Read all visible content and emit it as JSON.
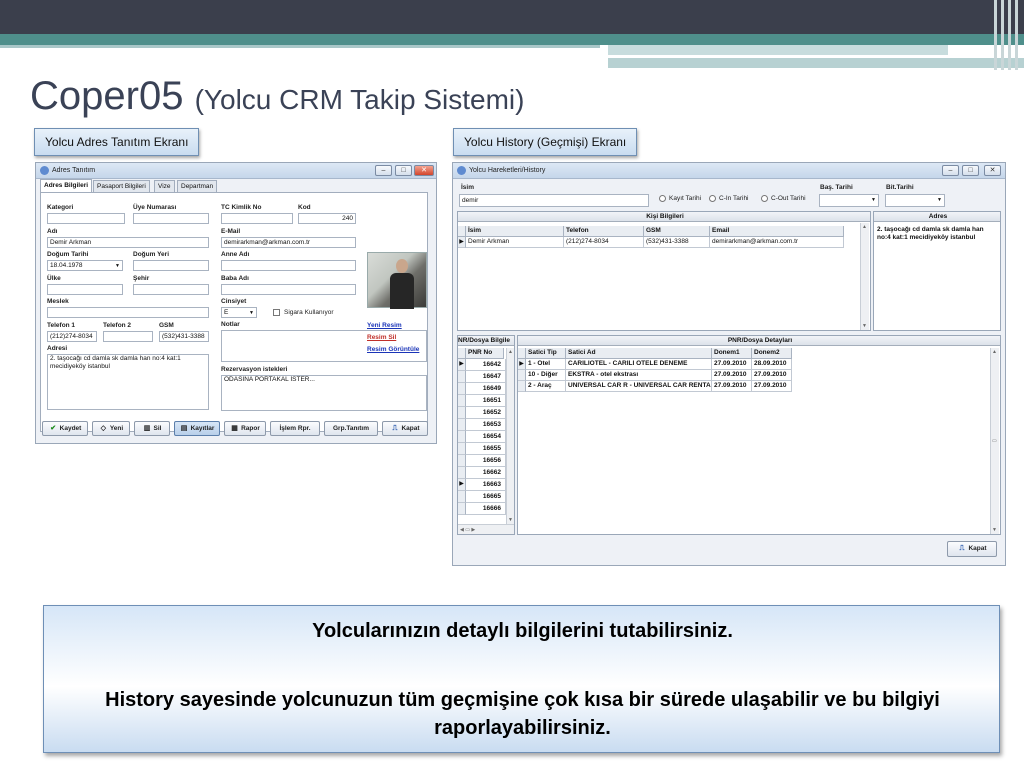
{
  "slide": {
    "title_main": "Coper05",
    "title_sub": "(Yolcu CRM Takip Sistemi)",
    "caption_left": "Yolcu Adres Tanıtım Ekranı",
    "caption_right": "Yolcu History (Geçmişi) Ekranı",
    "info_line1": "Yolcularınızın detaylı bilgilerini tutabilirsiniz.",
    "info_line2": "History sayesinde yolcunuzun tüm geçmişine çok kısa bir sürede ulaşabilir ve bu bilgiyi raporlayabilirsiniz."
  },
  "adres": {
    "window_title": "Adres Tanıtım",
    "tabs": [
      "Adres Bilgileri",
      "Pasaport Bilgileri",
      "Vize",
      "Departman"
    ],
    "labels": {
      "kategori": "Kategori",
      "uye_no": "Üye Numarası",
      "tc": "TC Kimlik No",
      "kod": "Kod",
      "adi": "Adı",
      "email": "E-Mail",
      "dogum_tarihi": "Doğum Tarihi",
      "dogum_yeri": "Doğum Yeri",
      "anne": "Anne Adı",
      "ulke": "Ülke",
      "sehir": "Şehir",
      "baba": "Baba Adı",
      "meslek": "Meslek",
      "cinsiyet": "Cinsiyet",
      "sigara": "Sigara Kullanıyor",
      "tel1": "Telefon 1",
      "tel2": "Telefon 2",
      "gsm": "GSM",
      "notlar": "Notlar",
      "adresi": "Adresi",
      "rezervasyon": "Rezervasyon istekleri"
    },
    "values": {
      "kod": "240",
      "adi": "Demir Arkman",
      "email": "demirarkman@arkman.com.tr",
      "dogum_tarihi": "18.04.1978",
      "cinsiyet": "E",
      "tel1": "(212)274-8034",
      "gsm": "(532)431-3388",
      "adresi": "2. taşocağı cd damla sk damla han no:4 kat:1 mecidiyeköy istanbul",
      "rezervasyon": "ODASINA PORTAKAL İSTER..."
    },
    "links": [
      "Yeni Resim",
      "Resim Sil",
      "Resim Görüntüle"
    ],
    "buttons": [
      "Kaydet",
      "Yeni",
      "Sil",
      "Kayıtlar",
      "Rapor",
      "İşlem Rpr.",
      "Grp.Tanıtım",
      "Kapat"
    ]
  },
  "history": {
    "window_title": "Yolcu Hareketleri/History",
    "isim_label": "İsim",
    "isim_value": "demir",
    "radios": [
      "Kayıt Tarihi",
      "C-In Tarihi",
      "C-Out Tarihi"
    ],
    "bas_tarihi": "Baş. Tarihi",
    "bit_tarihi": "Bit.Tarihi",
    "kisi_header": "Kişi Bilgileri",
    "adres_header": "Adres",
    "kisi_columns": [
      "İsim",
      "Telefon",
      "GSM",
      "Email"
    ],
    "kisi_row": [
      "Demir Arkman",
      "(212)274-8034",
      "(532)431-3388",
      "demirarkman@arkman.com.tr"
    ],
    "adres_text": "2. taşocağı cd damla sk damla han no:4 kat:1 mecidiyeköy istanbul",
    "pnr_header": "NR/Dosya Bilgile",
    "pnr_column": "PNR No",
    "pnr_list": [
      "16642",
      "16647",
      "16649",
      "16651",
      "16652",
      "16653",
      "16654",
      "16655",
      "16656",
      "16662",
      "16663",
      "16665",
      "16666"
    ],
    "detay_header": "PNR/Dosya Detayları",
    "detay_columns": [
      "Satici Tip",
      "Satici Ad",
      "Donem1",
      "Donem2"
    ],
    "detay_rows": [
      [
        "1 - Otel",
        "CARILIOTEL - CARILI OTELE DENEME",
        "27.09.2010",
        "28.09.2010"
      ],
      [
        "10 - Diğer",
        "EKSTRA - otel ekstrası",
        "27.09.2010",
        "27.09.2010"
      ],
      [
        "2 - Araç",
        "UNIVERSAL CAR R - UNIVERSAL CAR RENTA",
        "27.09.2010",
        "27.09.2010"
      ]
    ],
    "kapat": "Kapat"
  },
  "colors": {
    "accent_teal": "#4f8f8b",
    "header_dark": "#3b3f4c",
    "title_text": "#3a4256",
    "link_blue": "#1a34b8"
  }
}
